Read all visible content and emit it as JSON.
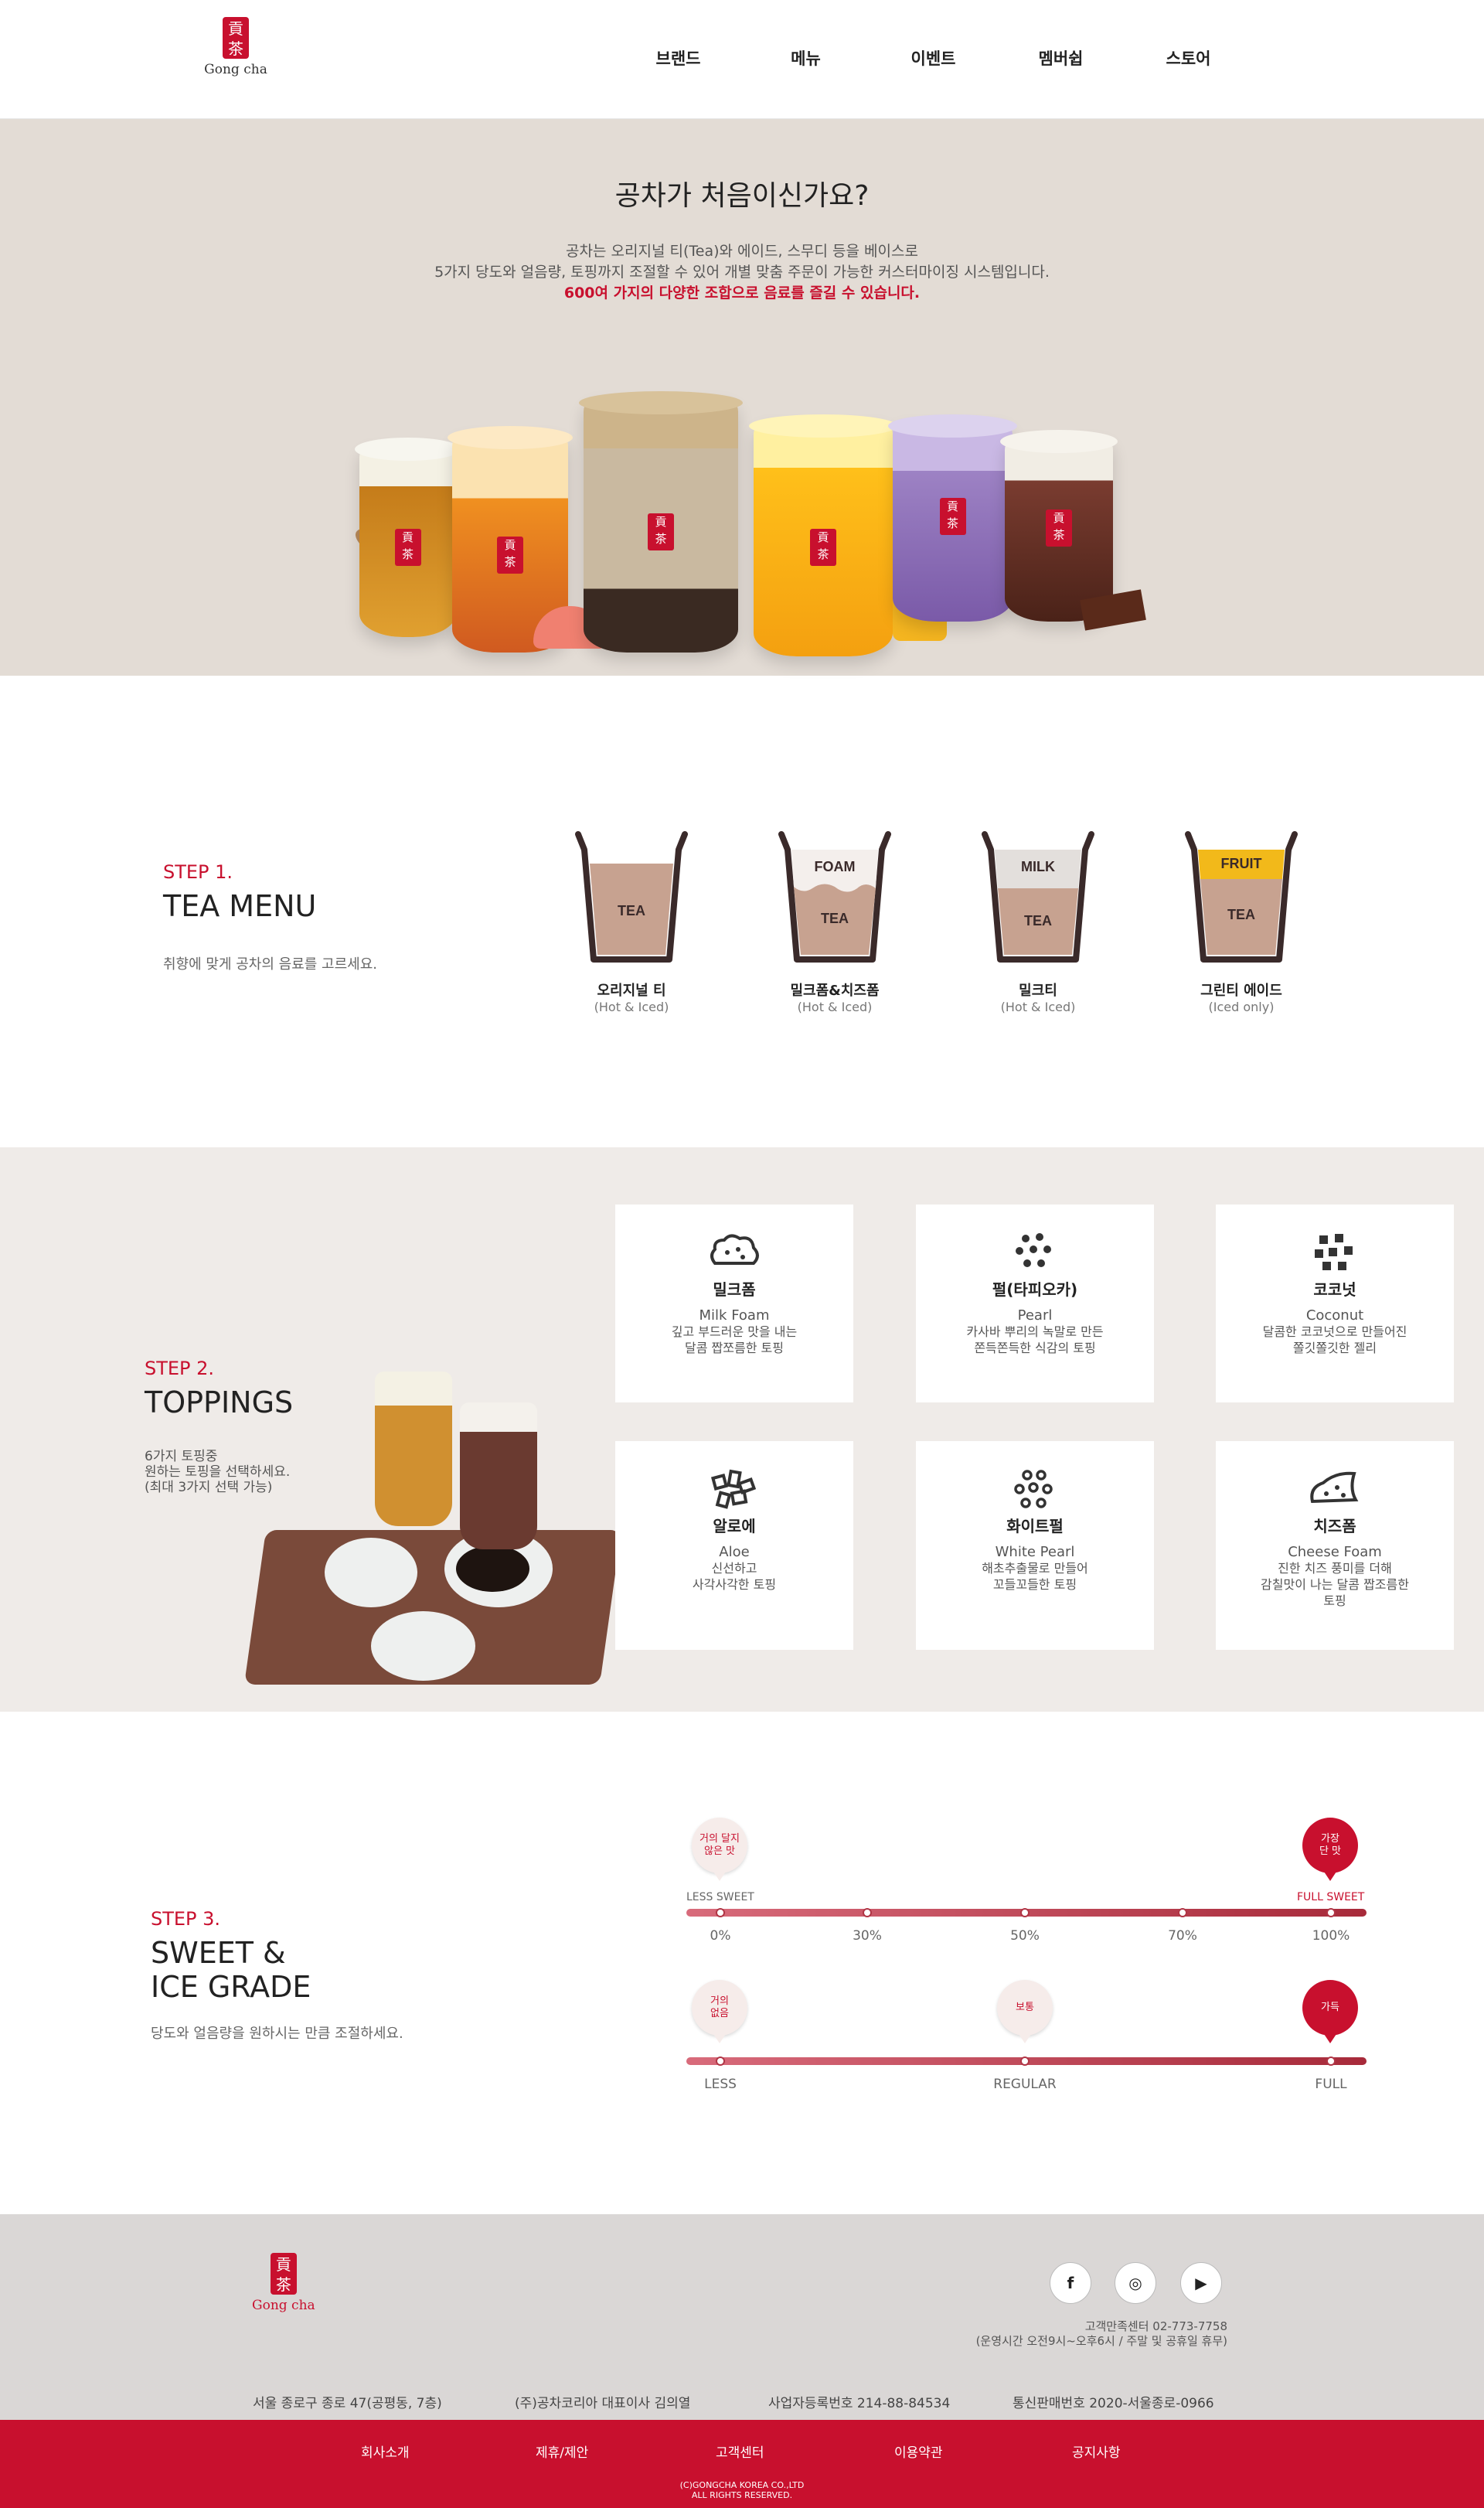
{
  "header": {
    "logo_text": "Gong cha",
    "nav": [
      "브랜드",
      "메뉴",
      "이벤트",
      "멤버쉽",
      "스토어"
    ]
  },
  "intro": {
    "title": "공차가 처음이신가요?",
    "line1": "공차는 오리지널 티(Tea)와 에이드, 스무디 등을 베이스로",
    "line2": "5가지 당도와 얼음량, 토핑까지 조절할 수 있어 개별 맞춤 주문이 가능한 커스터마이징 시스템입니다.",
    "highlight": "600여 가지의 다양한 조합으로 음료를 즐길 수 있습니다."
  },
  "step1": {
    "label": "STEP 1.",
    "title": "TEA MENU",
    "desc": "취향에 맞게 공차의 음료를 고르세요.",
    "items": [
      {
        "name": "오리지널 티",
        "sub": "(Hot & Iced)",
        "layers": [
          "TEA"
        ]
      },
      {
        "name": "밀크폼&치즈폼",
        "sub": "(Hot & Iced)",
        "layers": [
          "FOAM",
          "TEA"
        ]
      },
      {
        "name": "밀크티",
        "sub": "(Hot & Iced)",
        "layers": [
          "MILK",
          "TEA"
        ]
      },
      {
        "name": "그린티 에이드",
        "sub": "(Iced only)",
        "layers": [
          "FRUIT",
          "TEA"
        ]
      }
    ]
  },
  "step2": {
    "label": "STEP 2.",
    "title": "TOPPINGS",
    "desc": [
      "6가지 토핑중",
      "원하는 토핑을 선택하세요.",
      "(최대 3가지 선택 가능)"
    ],
    "cards": [
      {
        "icon": "milk-foam-icon",
        "kr": "밀크폼",
        "en": "Milk Foam",
        "desc": [
          "깊고 부드러운 맛을 내는",
          "달콤 짭쪼름한 토핑"
        ]
      },
      {
        "icon": "pearl-icon",
        "kr": "펄(타피오카)",
        "en": "Pearl",
        "desc": [
          "카사바 뿌리의 녹말로 만든",
          "쫀득쫀득한 식감의 토핑"
        ]
      },
      {
        "icon": "coconut-icon",
        "kr": "코코넛",
        "en": "Coconut",
        "desc": [
          "달콤한 코코넛으로 만들어진",
          "쫄깃쫄깃한 젤리"
        ]
      },
      {
        "icon": "aloe-icon",
        "kr": "알로에",
        "en": "Aloe",
        "desc": [
          "신선하고",
          "사각사각한 토핑"
        ]
      },
      {
        "icon": "white-pearl-icon",
        "kr": "화이트펄",
        "en": "White Pearl",
        "desc": [
          "해초추출물로 만들어",
          "꼬들꼬들한 토핑"
        ]
      },
      {
        "icon": "cheese-foam-icon",
        "kr": "치즈폼",
        "en": "Cheese Foam",
        "desc": [
          "진한 치즈 풍미를 더해",
          "감칠맛이 나는 달콤 짭조름한",
          "토핑"
        ]
      }
    ]
  },
  "step3": {
    "label": "STEP 3.",
    "title1": "SWEET &",
    "title2": "ICE GRADE",
    "desc": "당도와 얼음량을 원하시는 만큼 조절하세요.",
    "sweet": {
      "less": "LESS SWEET",
      "full": "FULL SWEET",
      "bubble_low": [
        "거의 달지",
        "않은 맛"
      ],
      "bubble_high": [
        "가장",
        "단 맛"
      ],
      "ticks": [
        "0%",
        "30%",
        "50%",
        "70%",
        "100%"
      ]
    },
    "ice": {
      "bubble_low": [
        "거의",
        "없음"
      ],
      "bubble_mid": "보통",
      "bubble_high": "가득",
      "ticks": [
        "LESS",
        "REGULAR",
        "FULL"
      ]
    }
  },
  "footer": {
    "logo_text": "Gong cha",
    "social": [
      "f",
      "◎",
      "▶"
    ],
    "cs_line1": "고객만족센터 02-773-7758",
    "cs_line2": "(운영시간 오전9시~오후6시 / 주말 및 공휴일 휴무)",
    "info": [
      "서울 종로구 종로 47(공평동, 7층)",
      "(주)공차코리아 대표이사 김의열",
      "사업자등록번호 214-88-84534",
      "통신판매번호 2020-서울종로-0966"
    ],
    "links": [
      "회사소개",
      "제휴/제안",
      "고객센터",
      "이용약관",
      "공지사항"
    ],
    "copy1": "(C)GONGCHA KOREA CO.,LTD",
    "copy2": "ALL RIGHTS RESERVED."
  },
  "colors": {
    "brand": "#c8102e",
    "beige": "#e3dcd5",
    "gray": "#efebe8"
  }
}
